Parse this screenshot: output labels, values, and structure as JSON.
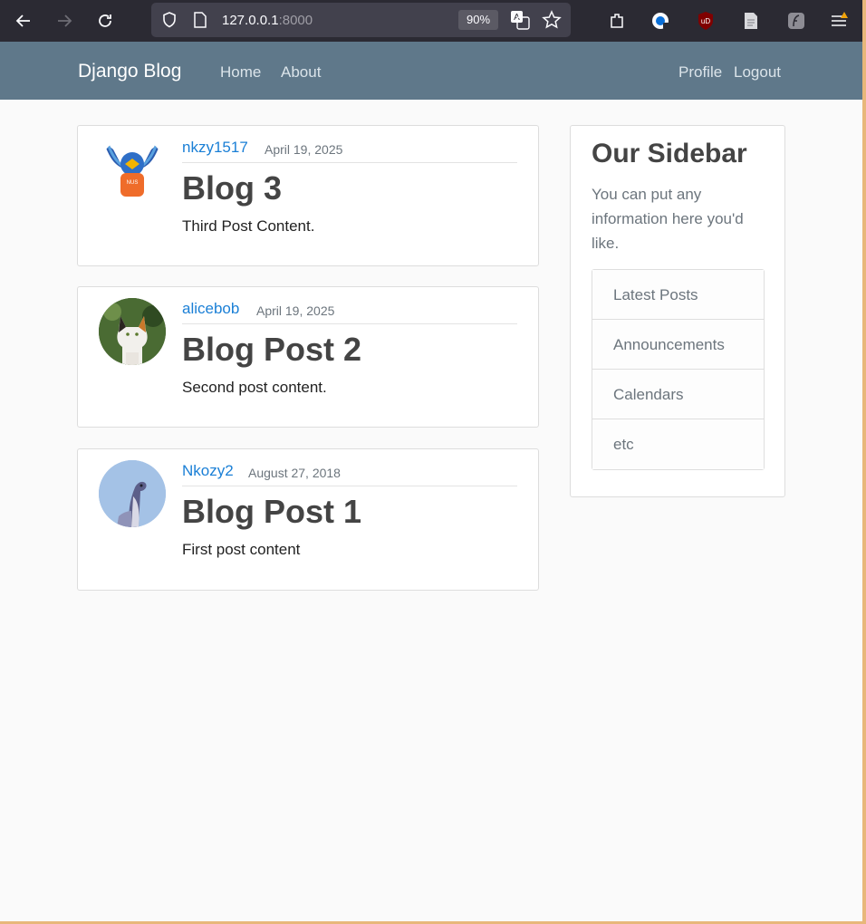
{
  "browser": {
    "url_host": "127.0.0.1",
    "url_port": ":8000",
    "zoom": "90%",
    "icons": [
      "back-icon",
      "forward-icon",
      "reload-icon",
      "shield-icon",
      "page-icon",
      "translate-icon",
      "star-icon",
      "extensions-icon",
      "password-manager-icon",
      "ublock-icon",
      "reader-icon",
      "feather-icon",
      "menu-icon"
    ]
  },
  "navbar": {
    "brand": "Django Blog",
    "left_links": [
      "Home",
      "About"
    ],
    "right_links": [
      "Profile",
      "Logout"
    ],
    "color": "#5f788a"
  },
  "posts": [
    {
      "author": "nkzy1517",
      "date": "April 19, 2025",
      "title": "Blog 3",
      "content": "Third Post Content."
    },
    {
      "author": "alicebob",
      "date": "April 19, 2025",
      "title": "Blog Post 2",
      "content": "Second post content."
    },
    {
      "author": "Nkozy2",
      "date": "August 27, 2018",
      "title": "Blog Post 1",
      "content": "First post content"
    }
  ],
  "sidebar": {
    "title": "Our Sidebar",
    "description": "You can put any information here you'd like.",
    "items": [
      "Latest Posts",
      "Announcements",
      "Calendars",
      "etc"
    ]
  },
  "colors": {
    "link": "#1a7fd6",
    "muted": "#6c757d"
  }
}
